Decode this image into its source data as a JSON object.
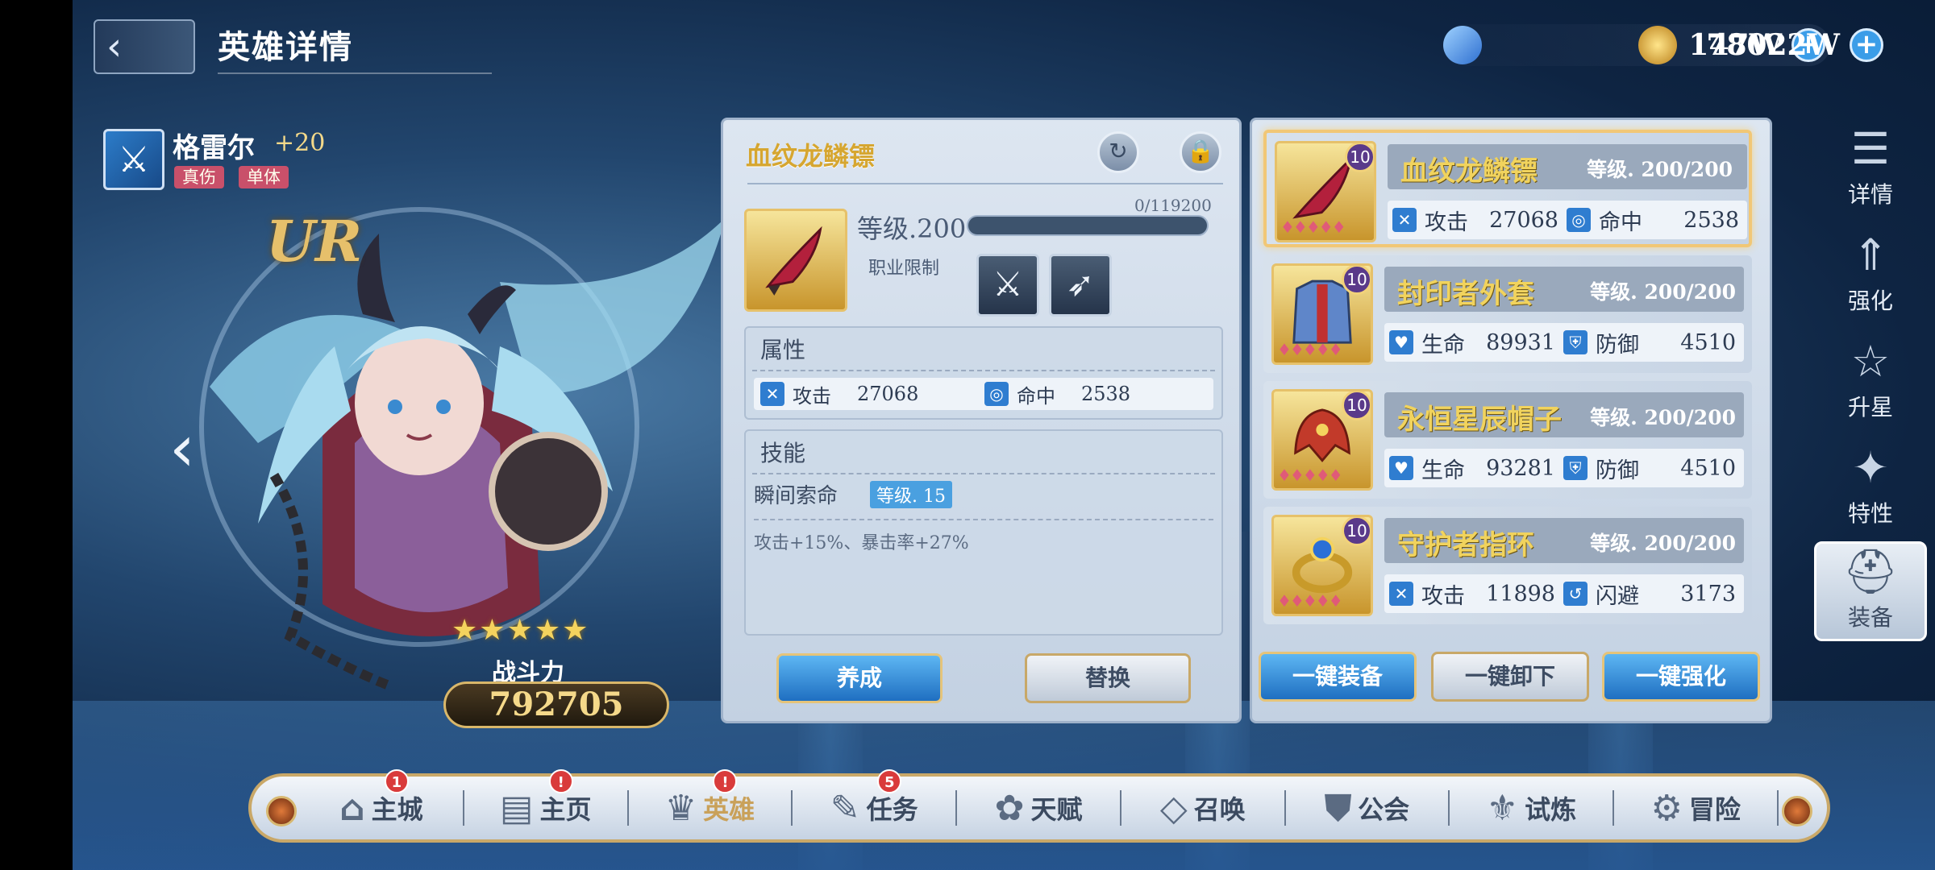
{
  "header": {
    "back_icon": "chevron-left-icon",
    "title": "英雄详情"
  },
  "currencies": [
    {
      "icon": "diamond-icon",
      "value": "147W",
      "color": "#3b8ee0"
    },
    {
      "icon": "gold-coin-icon",
      "value": "78022W",
      "color": "#d9a635"
    }
  ],
  "hero": {
    "class_icon": "sword-icon",
    "name": "格雷尔",
    "plus": "+20",
    "tags": [
      "真伤",
      "单体"
    ],
    "rarity": "UR",
    "stars": 5,
    "power_label": "战斗力",
    "power": "792705"
  },
  "item_panel": {
    "title": "血纹龙鳞镖",
    "level_label": "等级.200",
    "exp_text": "0/119200",
    "exp_fraction": 0,
    "restrict_label": "职业限制",
    "class_icons": [
      "sword-icon",
      "bow-icon"
    ],
    "attr_title": "属性",
    "stats": [
      {
        "icon": "attack-icon",
        "name": "攻击",
        "value": "27068"
      },
      {
        "icon": "accuracy-icon",
        "name": "命中",
        "value": "2538"
      }
    ],
    "skill_title": "技能",
    "skill_name": "瞬间索命",
    "skill_level": "等级. 15",
    "skill_desc": "攻击+15%、暴击率+27%",
    "btn_train": "养成",
    "btn_replace": "替换"
  },
  "equipment": [
    {
      "name": "血纹龙鳞镖",
      "badge": "10",
      "level": "等级. 200/200",
      "icon": "dart-blade-icon",
      "stats": [
        {
          "icon": "attack-icon",
          "name": "攻击",
          "value": "27068"
        },
        {
          "icon": "accuracy-icon",
          "name": "命中",
          "value": "2538"
        }
      ]
    },
    {
      "name": "封印者外套",
      "badge": "10",
      "level": "等级. 200/200",
      "icon": "armor-icon",
      "stats": [
        {
          "icon": "heart-icon",
          "name": "生命",
          "value": "89931"
        },
        {
          "icon": "shield-icon",
          "name": "防御",
          "value": "4510"
        }
      ]
    },
    {
      "name": "永恒星辰帽子",
      "badge": "10",
      "level": "等级. 200/200",
      "icon": "helmet-icon",
      "stats": [
        {
          "icon": "heart-icon",
          "name": "生命",
          "value": "93281"
        },
        {
          "icon": "shield-icon",
          "name": "防御",
          "value": "4510"
        }
      ]
    },
    {
      "name": "守护者指环",
      "badge": "10",
      "level": "等级. 200/200",
      "icon": "ring-icon",
      "stats": [
        {
          "icon": "attack-icon",
          "name": "攻击",
          "value": "11898"
        },
        {
          "icon": "dodge-icon",
          "name": "闪避",
          "value": "3173"
        }
      ]
    }
  ],
  "equip_buttons": {
    "equip_all": "一键装备",
    "unequip_all": "一键卸下",
    "enhance_all": "一键强化"
  },
  "side_tabs": [
    {
      "label": "详情",
      "icon": "scroll-icon"
    },
    {
      "label": "强化",
      "icon": "upgrade-icon"
    },
    {
      "label": "升星",
      "icon": "star-up-icon"
    },
    {
      "label": "特性",
      "icon": "trait-icon"
    },
    {
      "label": "装备",
      "icon": "helmet-icon"
    }
  ],
  "bottom_nav": [
    {
      "label": "主城",
      "icon": "castle-icon",
      "badge": "1"
    },
    {
      "label": "主页",
      "icon": "home-icon",
      "badge": "!"
    },
    {
      "label": "英雄",
      "icon": "hero-icon",
      "badge": "!"
    },
    {
      "label": "任务",
      "icon": "task-icon",
      "badge": "5"
    },
    {
      "label": "天赋",
      "icon": "talent-icon",
      "badge": ""
    },
    {
      "label": "召唤",
      "icon": "summon-icon",
      "badge": ""
    },
    {
      "label": "公会",
      "icon": "guild-icon",
      "badge": ""
    },
    {
      "label": "试炼",
      "icon": "trial-icon",
      "badge": ""
    },
    {
      "label": "冒险",
      "icon": "adventure-icon",
      "badge": ""
    }
  ]
}
